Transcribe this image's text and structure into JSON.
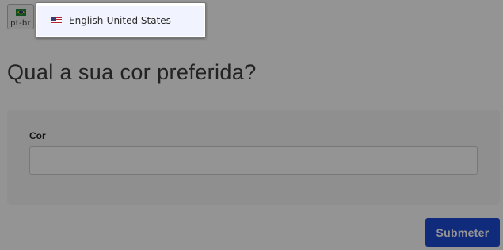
{
  "language_switcher": {
    "current_code": "pt-br",
    "current_flag_icon": "brazil-flag-icon",
    "options": [
      {
        "label": "English-United States",
        "flag_icon": "us-flag-icon"
      }
    ]
  },
  "page": {
    "title": "Qual a sua cor preferida?"
  },
  "form": {
    "field_label": "Cor",
    "field_value": "",
    "submit_label": "Submeter"
  },
  "colors": {
    "submit_button": "#1d4ad6",
    "overlay": "rgba(0,0,0,0.42)",
    "menu_option_highlight": "#f1f4fe"
  }
}
